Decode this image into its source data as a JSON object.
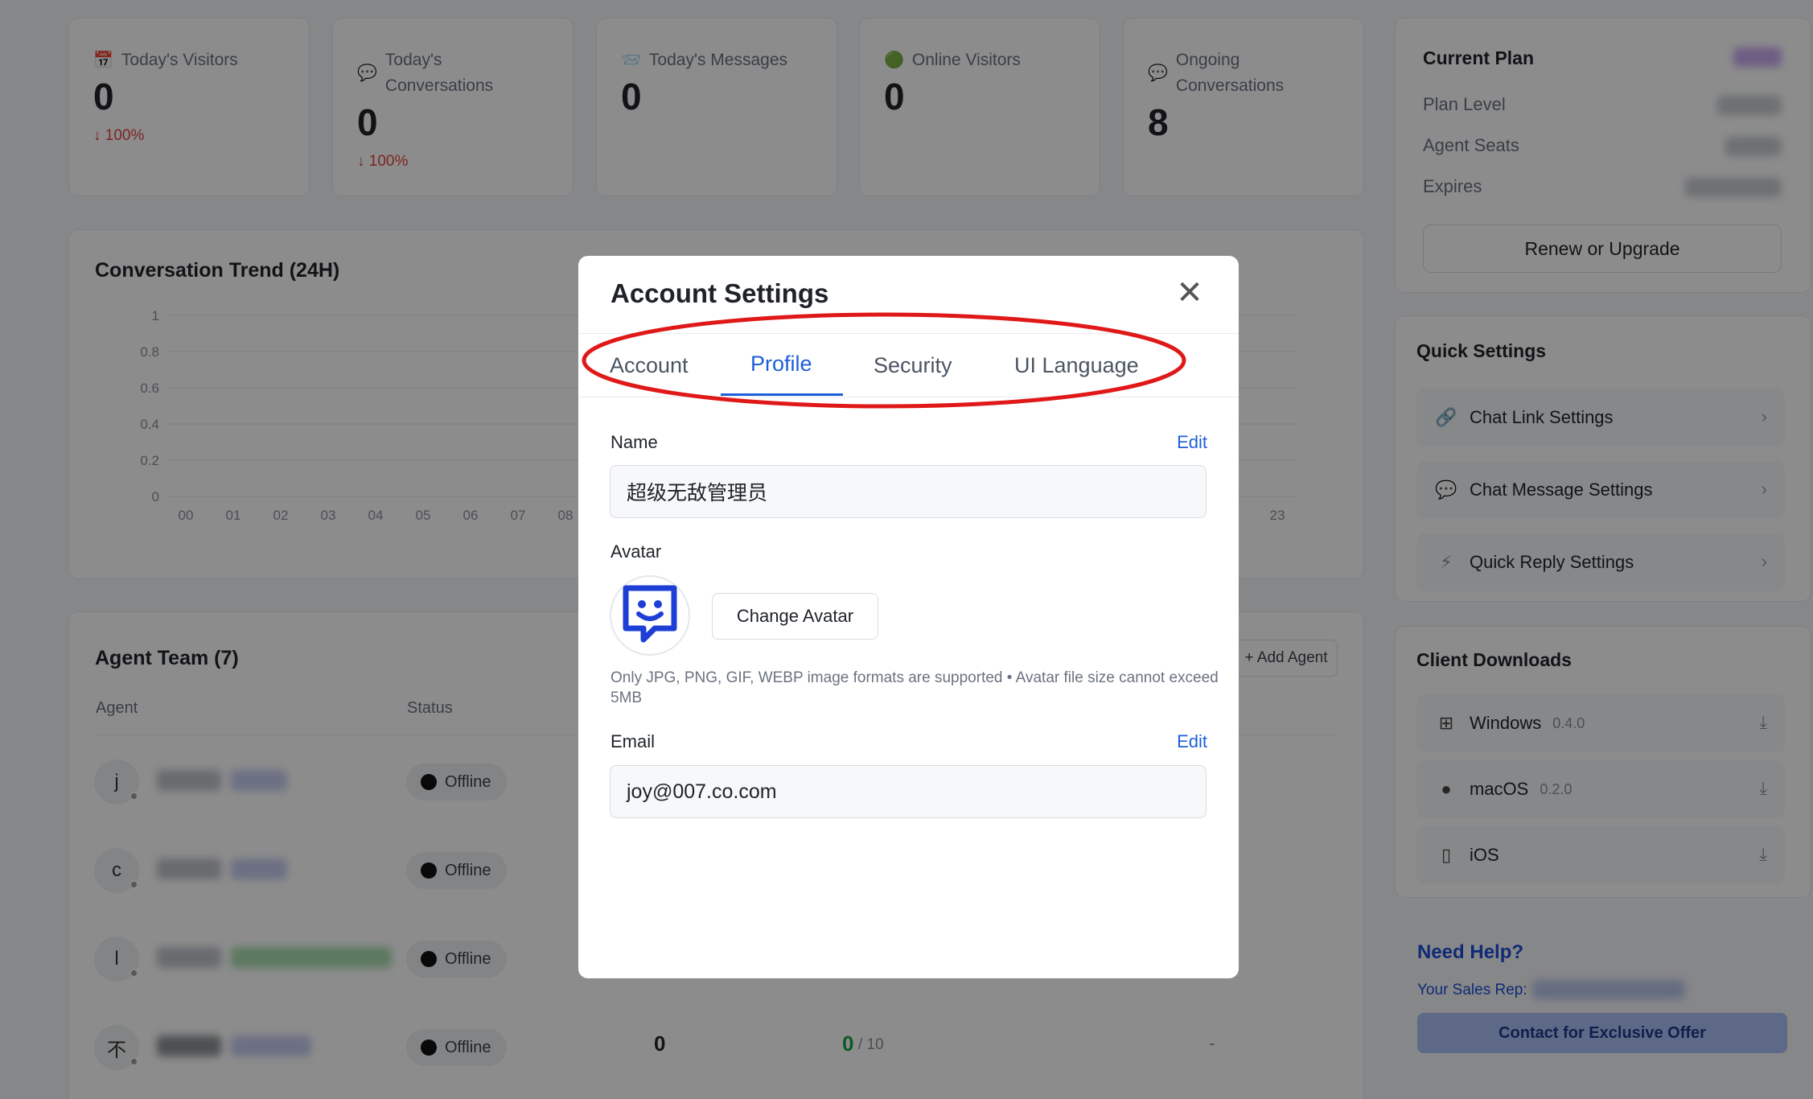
{
  "stats": [
    {
      "label": "Today's Visitors",
      "icon": "calendar-icon",
      "glyph": "📅",
      "value": "0",
      "change": "↓ 100%"
    },
    {
      "label": "Today's Conversations",
      "icon": "chat-bubble-icon",
      "glyph": "💬",
      "value": "0",
      "change": "↓ 100%"
    },
    {
      "label": "Today's Messages",
      "icon": "inbox-icon",
      "glyph": "📨",
      "value": "0",
      "change": ""
    },
    {
      "label": "Online Visitors",
      "icon": "green-dot-icon",
      "glyph": "🟢",
      "value": "0",
      "change": ""
    },
    {
      "label": "Ongoing Conversations",
      "icon": "chat-bubble-icon",
      "glyph": "💬",
      "value": "8",
      "change": ""
    }
  ],
  "trend": {
    "title": "Conversation Trend (24H)"
  },
  "chart_data": {
    "type": "line",
    "title": "Conversation Trend (24H)",
    "x": [
      "00",
      "01",
      "02",
      "03",
      "04",
      "05",
      "06",
      "07",
      "08",
      "23"
    ],
    "ylim": [
      0,
      1
    ],
    "yticks": [
      "1",
      "0.8",
      "0.6",
      "0.4",
      "0.2",
      "0"
    ],
    "grid": true,
    "series": []
  },
  "agents": {
    "title": "Agent Team (7)",
    "add_label": "+ Add Agent",
    "col_agent": "Agent",
    "col_status": "Status",
    "rows": [
      {
        "initial": "j",
        "status": "Offline"
      },
      {
        "initial": "c",
        "status": "Offline"
      },
      {
        "initial": "l",
        "status": "Offline"
      },
      {
        "initial": "不",
        "status": "Offline",
        "count": "0",
        "quota_used": "0",
        "quota_total": "/ 10",
        "dash": "-"
      }
    ]
  },
  "plan": {
    "title": "Current Plan",
    "level_label": "Plan Level",
    "seats_label": "Agent Seats",
    "expires_label": "Expires",
    "renew_label": "Renew or Upgrade"
  },
  "quick_settings": {
    "title": "Quick Settings",
    "items": [
      {
        "label": "Chat Link Settings",
        "glyph": "🔗"
      },
      {
        "label": "Chat Message Settings",
        "glyph": "💬"
      },
      {
        "label": "Quick Reply Settings",
        "glyph": "⚡"
      }
    ]
  },
  "downloads": {
    "title": "Client Downloads",
    "items": [
      {
        "label": "Windows",
        "version": "0.4.0",
        "glyph": "⊞"
      },
      {
        "label": "macOS",
        "version": "0.2.0",
        "glyph": ""
      },
      {
        "label": "iOS",
        "version": "",
        "glyph": "▯"
      }
    ]
  },
  "help": {
    "title": "Need Help?",
    "rep_label": "Your Sales Rep: ",
    "contact_label": "Contact for Exclusive Offer"
  },
  "modal": {
    "title": "Account Settings",
    "close_glyph": "✕",
    "tabs": [
      "Account",
      "Profile",
      "Security",
      "UI Language"
    ],
    "active_tab": "Profile",
    "name_label": "Name",
    "name_edit": "Edit",
    "name_value": "超级无敌管理员",
    "avatar_label": "Avatar",
    "change_avatar_label": "Change Avatar",
    "avatar_hint": "Only JPG, PNG, GIF, WEBP image formats are supported • Avatar file size cannot exceed 5MB",
    "email_label": "Email",
    "email_edit": "Edit",
    "email_value": "joy@007.co.com"
  },
  "colors": {
    "accent": "#1d5fd9",
    "highlight": "#e01818",
    "offline": "#111111",
    "quota_used": "#16a34a"
  }
}
